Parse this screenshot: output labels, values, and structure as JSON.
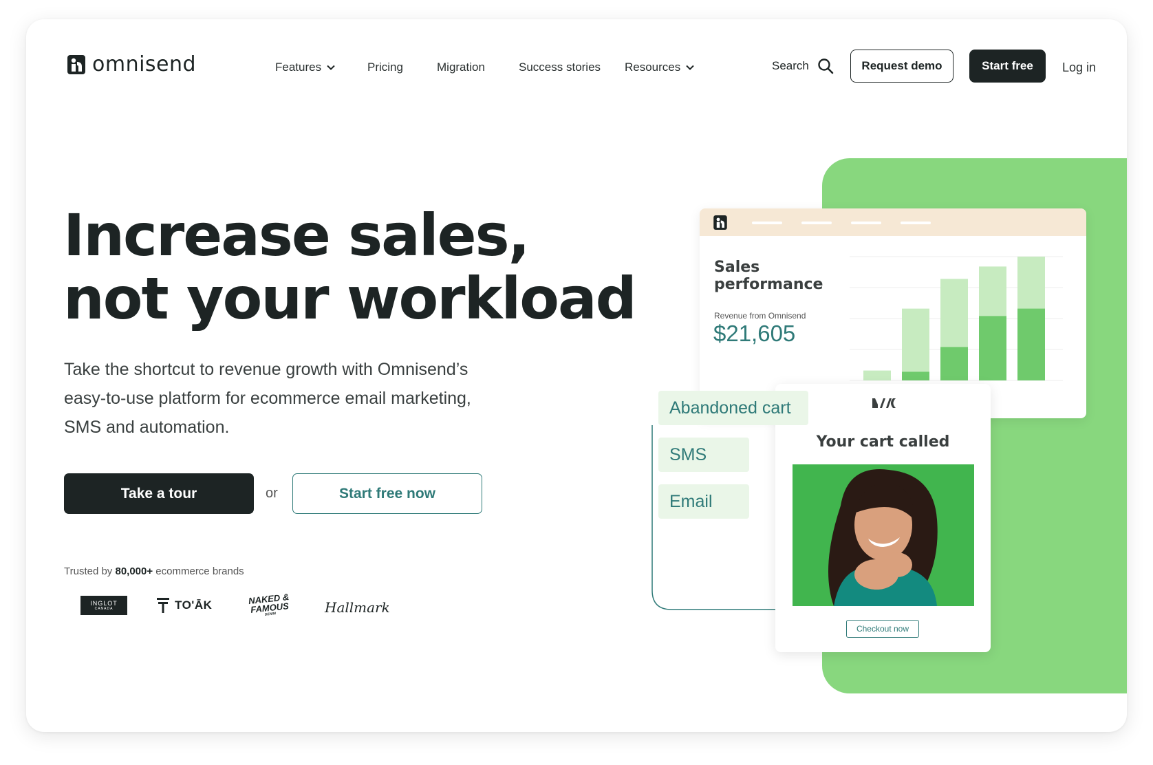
{
  "brand": {
    "name": "omnisend"
  },
  "nav": {
    "items": [
      {
        "label": "Features",
        "has_dropdown": true
      },
      {
        "label": "Pricing",
        "has_dropdown": false
      },
      {
        "label": "Migration",
        "has_dropdown": false
      },
      {
        "label": "Success stories",
        "has_dropdown": false
      },
      {
        "label": "Resources",
        "has_dropdown": true
      }
    ],
    "search_label": "Search",
    "request_demo": "Request demo",
    "start_free": "Start free",
    "login": "Log in"
  },
  "hero": {
    "headline_line1": "Increase sales,",
    "headline_line2": "not your workload",
    "subtext": "Take the shortcut to revenue growth with Omnisend’s easy-to-use platform for ecommerce email marketing, SMS and automation.",
    "tour_button": "Take a tour",
    "or_text": "or",
    "start_free_now": "Start free now",
    "trusted_prefix": "Trusted by",
    "trusted_count": "80,000+",
    "trusted_suffix": "ecommerce brands",
    "brands": {
      "inglot_main": "INGLOT",
      "inglot_sub": "CANADA",
      "toak": "TO'ĀK",
      "naked_line1": "NAKED &",
      "naked_line2": "FAMOUS",
      "naked_line3": "DENIM",
      "hallmark": "Hallmark"
    }
  },
  "illustration": {
    "sales_card": {
      "title": "Sales performance",
      "revenue_label": "Revenue from Omnisend",
      "revenue_value": "$21,605",
      "bars": [
        {
          "total": 0.08,
          "highlight": 0.0
        },
        {
          "total": 0.58,
          "highlight": 0.07
        },
        {
          "total": 0.82,
          "highlight": 0.27
        },
        {
          "total": 0.92,
          "highlight": 0.52
        },
        {
          "total": 1.0,
          "highlight": 0.58
        }
      ]
    },
    "chips": [
      "Abandoned cart",
      "SMS",
      "Email"
    ],
    "email_card": {
      "logo_text": "MM",
      "title": "Your cart called",
      "cta": "Checkout now"
    }
  },
  "colors": {
    "dark": "#1d2424",
    "teal": "#2f7a78",
    "green_bg": "#88d77e",
    "bar_dark": "#6fca6c",
    "bar_light": "#c7ebc0",
    "card_header": "#f6e8d5",
    "chip_bg": "#eaf6e8"
  }
}
